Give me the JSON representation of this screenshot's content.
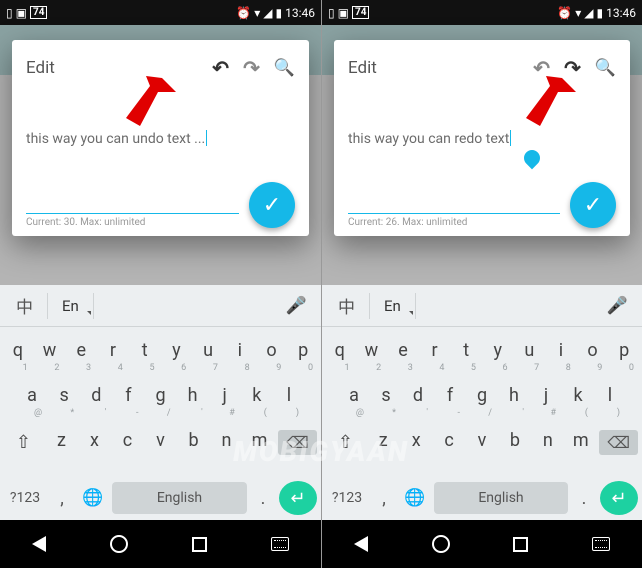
{
  "status": {
    "battery": "74",
    "time": "13:46"
  },
  "appTitle": "MobiGyaan",
  "left": {
    "dialogTitle": "Edit",
    "text": "this way you can undo text ...",
    "counter": "Current: 30. Max: unlimited"
  },
  "right": {
    "dialogTitle": "Edit",
    "text": "this way you can redo text",
    "counter": "Current: 26. Max: unlimited"
  },
  "keyboard": {
    "langZh": "中",
    "langEn": "En",
    "row1": [
      "q",
      "w",
      "e",
      "r",
      "t",
      "y",
      "u",
      "i",
      "o",
      "p"
    ],
    "hint1": [
      "1",
      "2",
      "3",
      "4",
      "5",
      "6",
      "7",
      "8",
      "9",
      "0"
    ],
    "row2": [
      "a",
      "s",
      "d",
      "f",
      "g",
      "h",
      "j",
      "k",
      "l"
    ],
    "hint2": [
      "@",
      "*",
      "′",
      "-",
      "/",
      "′",
      "#",
      "(",
      ")"
    ],
    "row3": [
      "z",
      "x",
      "c",
      "v",
      "b",
      "n",
      "m"
    ],
    "sym": "?123",
    "space": "English"
  },
  "watermark": "MOBIGYAAN"
}
